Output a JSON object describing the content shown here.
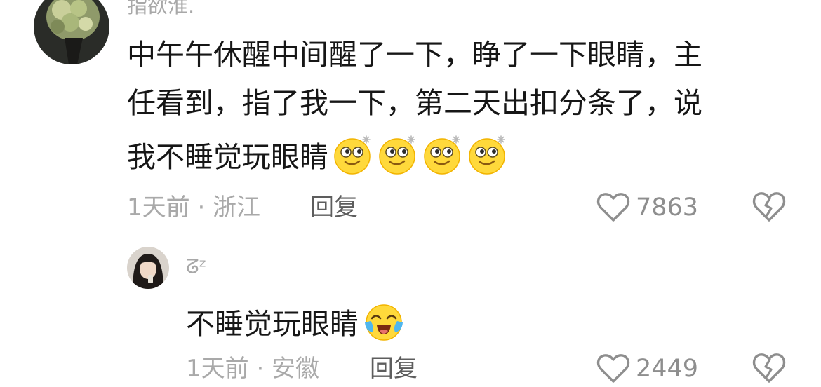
{
  "comments": [
    {
      "username": "指欲淮.",
      "text_lines": [
        "中午午休醒中间醒了一下，睁了一下眼睛，主",
        "任看到，指了我一下，第二天出扣分条了，说",
        "我不睡觉玩眼睛"
      ],
      "emoji": [
        "dizzy-eyes-emoji",
        "dizzy-eyes-emoji",
        "dizzy-eyes-emoji",
        "dizzy-eyes-emoji"
      ],
      "meta": "1天前 · 浙江",
      "reply_label": "回复",
      "likes": "7863"
    },
    {
      "username": "ᘔᶻ",
      "text_lines": [
        "不睡觉玩眼睛"
      ],
      "emoji": [
        "crying-laughing-emoji"
      ],
      "meta": "1天前 · 安徽",
      "reply_label": "回复",
      "likes": "2449"
    }
  ],
  "icons": {
    "like": "heart-outline-icon",
    "dislike": "broken-heart-icon"
  },
  "colors": {
    "text": "#161616",
    "muted": "#a9a9a9",
    "reply": "#5d5d5d",
    "emoji_face": "#ffd93b"
  }
}
